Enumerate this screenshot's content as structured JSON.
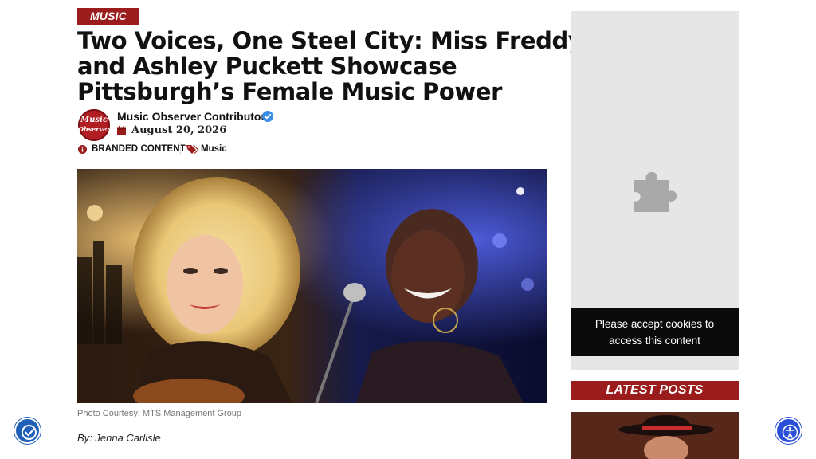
{
  "article": {
    "category": "MUSIC",
    "headline_lines": [
      "Two Voices, One Steel City: Miss Freddye",
      "and Ashley Puckett Showcase",
      "Pittsburgh’s Female Music Power"
    ],
    "author": {
      "logo_text_top": "Music",
      "logo_text_bottom": "Observer",
      "name": "Music Observer Contributor",
      "verified": true
    },
    "date": "August 20, 2026",
    "branded_label": "BRANDED CONTENT",
    "tag": "Music",
    "photo_caption": "Photo Courtesy: MTS Management Group",
    "byline": "By: Jenna Carlisle"
  },
  "sidebar": {
    "ad_placeholder_icon": "puzzle-icon",
    "cookie_notice": [
      "Please accept cookies to",
      "access this content"
    ],
    "latest_posts_title": "LATEST POSTS"
  },
  "widgets": {
    "left_icon": "accessibility-check-icon",
    "right_icon": "accessibility-person-icon"
  },
  "colors": {
    "brand_red": "#9b1c1c",
    "verified_blue": "#3b8ee8",
    "cookie_bg": "#0a0a0a",
    "ad_bg": "#e6e6e6"
  }
}
